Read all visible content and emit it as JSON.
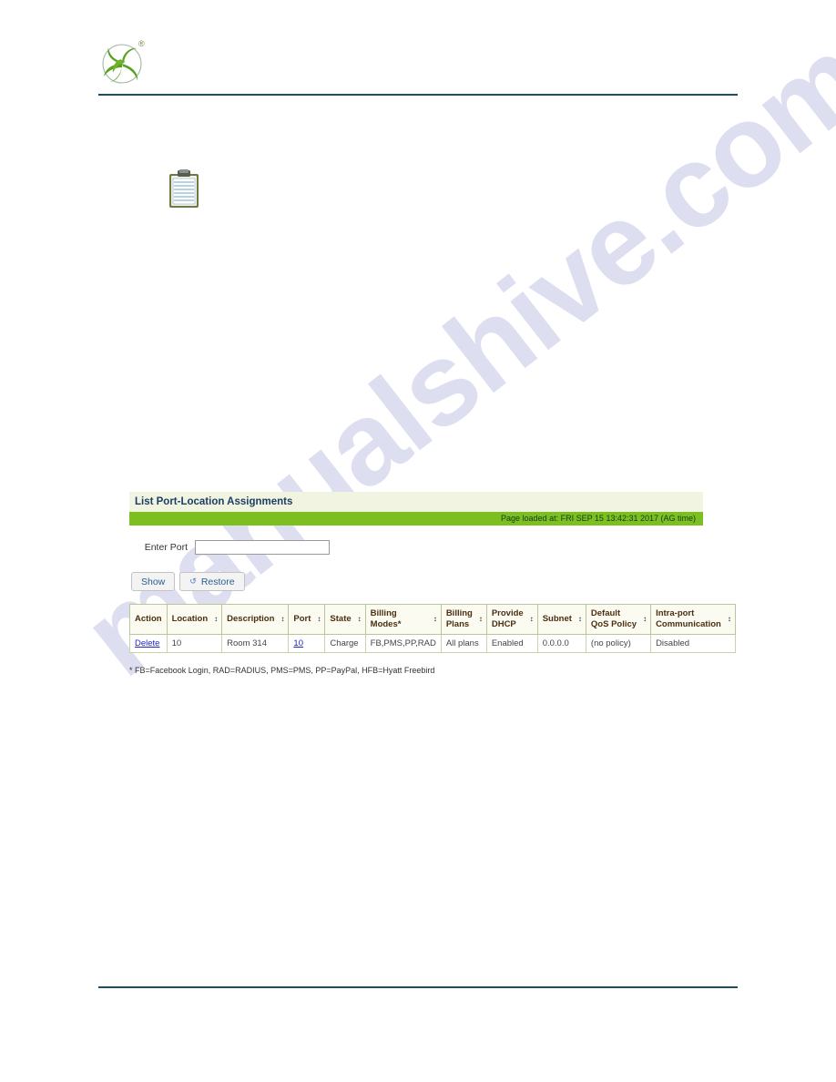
{
  "document": {
    "watermark_text": "manualshive.com",
    "logo_alt": "company-logo",
    "registered_mark": "®"
  },
  "panel": {
    "title": "List Port-Location Assignments",
    "status_bar": "Page loaded at:  FRI SEP 15 13:42:31 2017  (AG time)"
  },
  "form": {
    "port_label": "Enter Port",
    "port_value": "",
    "port_placeholder": "",
    "show_button": "Show",
    "restore_button": "Restore",
    "restore_icon": "refresh-icon"
  },
  "table": {
    "columns": [
      {
        "label_line1": "Action",
        "label_line2": "",
        "sortable": false
      },
      {
        "label_line1": "Location",
        "label_line2": "",
        "sortable": true
      },
      {
        "label_line1": "Description",
        "label_line2": "",
        "sortable": true
      },
      {
        "label_line1": "Port",
        "label_line2": "",
        "sortable": true
      },
      {
        "label_line1": "State",
        "label_line2": "",
        "sortable": true
      },
      {
        "label_line1": "Billing",
        "label_line2": "Modes*",
        "sortable": true
      },
      {
        "label_line1": "Billing",
        "label_line2": "Plans",
        "sortable": true
      },
      {
        "label_line1": "Provide",
        "label_line2": "DHCP",
        "sortable": true
      },
      {
        "label_line1": "Subnet",
        "label_line2": "",
        "sortable": true
      },
      {
        "label_line1": "Default",
        "label_line2": "QoS Policy",
        "sortable": true
      },
      {
        "label_line1": "Intra-port",
        "label_line2": "Communication",
        "sortable": true
      }
    ],
    "sort_glyph": "↕",
    "rows": [
      {
        "action": "Delete",
        "location": "10",
        "description": "Room 314",
        "port": "10",
        "state": "Charge",
        "billing_modes": "FB,PMS,PP,RAD",
        "billing_plans": "All plans",
        "provide_dhcp": "Enabled",
        "subnet": "0.0.0.0",
        "default_qos_policy": "(no policy)",
        "intra_port_communication": "Disabled"
      }
    ]
  },
  "footnote": "* FB=Facebook Login, RAD=RADIUS, PMS=PMS, PP=PayPal, HFB=Hyatt Freebird",
  "colors": {
    "rule": "#1f4e62",
    "panel_title_bg": "#f1f4e0",
    "green_bar": "#7bc020",
    "table_header_bg": "#fbfbf1",
    "link": "#2222cc",
    "logo_green": "#5aa021"
  }
}
